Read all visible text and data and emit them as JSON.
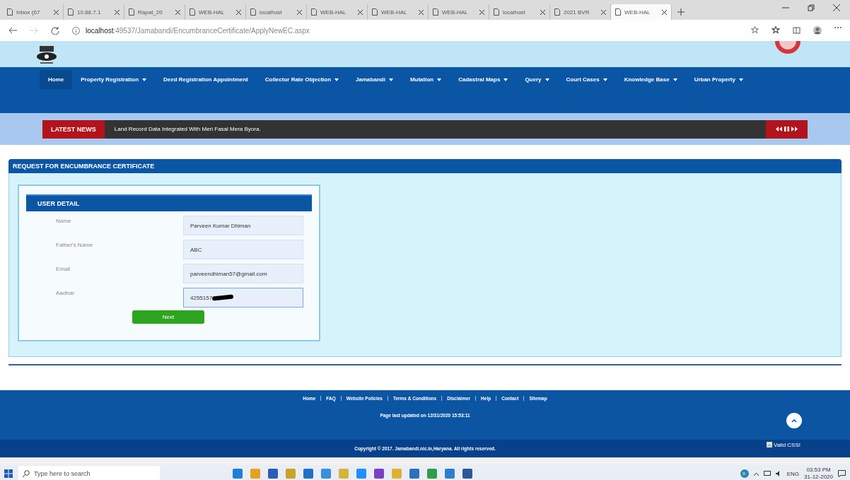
{
  "browser": {
    "tabs": [
      {
        "title": "Inbox (67",
        "selected": false
      },
      {
        "title": "10.88.7.1",
        "selected": false
      },
      {
        "title": "Rapat_20",
        "selected": false
      },
      {
        "title": "WEB-HAL",
        "selected": false
      },
      {
        "title": "localhost",
        "selected": false
      },
      {
        "title": "WEB-HAL",
        "selected": false
      },
      {
        "title": "WEB-HAL",
        "selected": false
      },
      {
        "title": "WEB-HAL",
        "selected": false
      },
      {
        "title": "localhost",
        "selected": false
      },
      {
        "title": "2021 BVR",
        "selected": false
      },
      {
        "title": "WEB-HAL",
        "selected": true
      }
    ],
    "url_host": "localhost",
    "url_path": ":49537/Jamabandi/EncumbranceCertificate/ApplyNewEC.aspx"
  },
  "nav": [
    {
      "label": "Home",
      "dropdown": false,
      "selected": true
    },
    {
      "label": "Property Registration",
      "dropdown": true,
      "selected": false
    },
    {
      "label": "Deed Registration Appointment",
      "dropdown": false,
      "selected": false
    },
    {
      "label": "Collector Rate Objection",
      "dropdown": true,
      "selected": false
    },
    {
      "label": "Jamabandi",
      "dropdown": true,
      "selected": false
    },
    {
      "label": "Mutation",
      "dropdown": true,
      "selected": false
    },
    {
      "label": "Cadastral Maps",
      "dropdown": true,
      "selected": false
    },
    {
      "label": "Query",
      "dropdown": true,
      "selected": false
    },
    {
      "label": "Court Cases",
      "dropdown": true,
      "selected": false
    },
    {
      "label": "Knowledge Base",
      "dropdown": true,
      "selected": false
    },
    {
      "label": "Urban Property",
      "dropdown": true,
      "selected": false
    }
  ],
  "news": {
    "label": "LATEST NEWS",
    "text": "Land Record Data Integrated With Meri Fasal Mera Byora."
  },
  "section": {
    "title": "REQUEST FOR ENCUMBRANCE CERTIFICATE"
  },
  "user_detail": {
    "title": "USER DETAIL",
    "fields": [
      {
        "label": "Name",
        "value": "Parveen Kumar Dhiman",
        "focused": false,
        "redacted": false
      },
      {
        "label": "Father's Name",
        "value": "ABC",
        "focused": false,
        "redacted": false
      },
      {
        "label": "Email",
        "value": "parveendhiman57@gmail.com",
        "focused": false,
        "redacted": false
      },
      {
        "label": "Aadhar",
        "value": "4255157",
        "focused": true,
        "redacted": true
      }
    ],
    "button": "Next"
  },
  "footer": {
    "links": [
      "Home",
      "FAQ",
      "Website Policies",
      "Terms & Conditions",
      "Disclaimer",
      "Help",
      "Contact",
      "Sitemap"
    ],
    "updated": "Page last updated on 12/31/2020 15:53:11",
    "copyright": "Copyright © 2017.  Jamabandi.nic.in,Haryana. All rights reserved.",
    "badge": "Valid CSS!"
  },
  "taskbar": {
    "search_placeholder": "Type here to search",
    "language": "ENG",
    "time": "03:53 PM",
    "date": "31-12-2020"
  }
}
